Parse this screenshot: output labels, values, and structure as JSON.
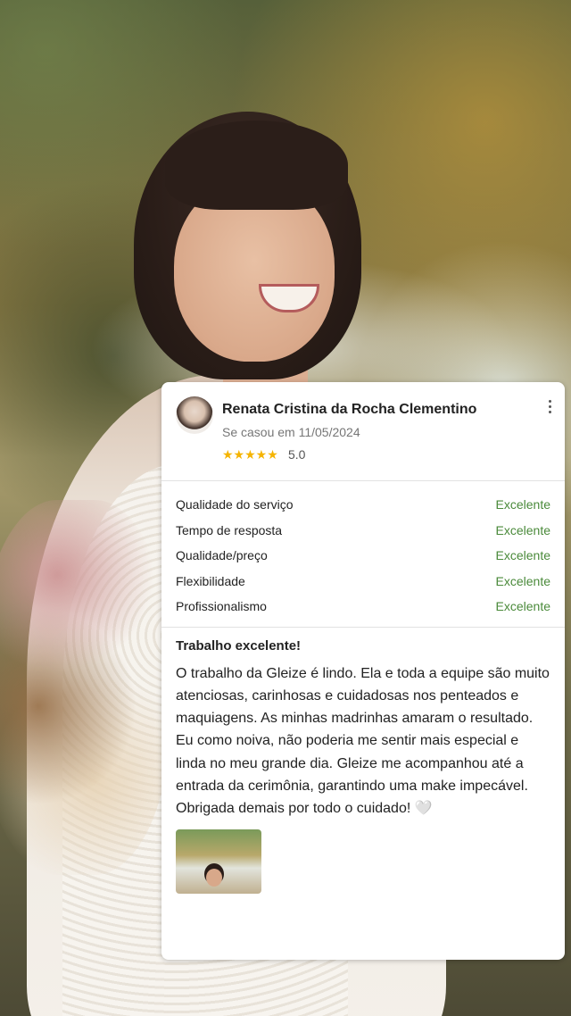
{
  "review_card": {
    "reviewer_name": "Renata Cristina da Rocha Clementino",
    "married_text": "Se casou em 11/05/2024",
    "stars": "★★★★★",
    "rating": "5.0",
    "criteria": [
      {
        "label": "Qualidade do serviço",
        "value": "Excelente"
      },
      {
        "label": "Tempo de resposta",
        "value": "Excelente"
      },
      {
        "label": "Qualidade/preço",
        "value": "Excelente"
      },
      {
        "label": "Flexibilidade",
        "value": "Excelente"
      },
      {
        "label": "Profissionalismo",
        "value": "Excelente"
      }
    ],
    "review_title": "Trabalho excelente!",
    "review_text": "O trabalho da Gleize é lindo. Ela e toda a equipe são muito atenciosas, carinhosas e cuidadosas nos penteados e maquiagens. As minhas madrinhas amaram o resultado. Eu como noiva, não poderia me sentir mais especial e linda no meu grande dia. Gleize me acompanhou até a entrada da cerimônia, garantindo uma make impecável. Obrigada demais por todo o cuidado! 🤍"
  },
  "colors": {
    "accent_green": "#4a8a3a",
    "star_yellow": "#f5b400"
  },
  "icons": [
    "kebab-menu-icon",
    "star-icon"
  ]
}
